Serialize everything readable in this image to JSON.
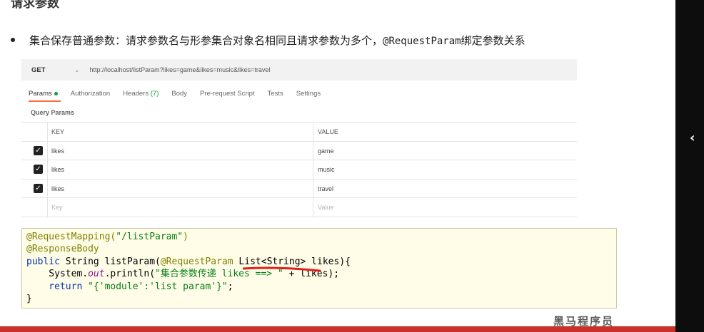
{
  "heading": "请求参数",
  "bullet": {
    "text": "集合保存普通参数：请求参数名与形参集合对象名相同且请求参数为多个，",
    "code": "@RequestParam",
    "tail": "绑定参数关系"
  },
  "postman": {
    "method": "GET",
    "url": "http://localhost/listParam?likes=game&likes=music&likes=travel",
    "tabs": [
      {
        "label": "Params"
      },
      {
        "label": "Authorization"
      },
      {
        "label": "Headers",
        "count": "(7)"
      },
      {
        "label": "Body"
      },
      {
        "label": "Pre-request Script"
      },
      {
        "label": "Tests"
      },
      {
        "label": "Settings"
      }
    ],
    "query_title": "Query Params",
    "headers": {
      "key": "KEY",
      "value": "VALUE"
    },
    "rows": [
      {
        "key": "likes",
        "value": "game"
      },
      {
        "key": "likes",
        "value": "music"
      },
      {
        "key": "likes",
        "value": "travel"
      }
    ],
    "placeholder": {
      "key": "Key",
      "value": "Value"
    }
  },
  "code": {
    "l1_anno": "@RequestMapping(",
    "l1_str": "\"/listParam\"",
    "l1_end": ")",
    "l2_anno": "@ResponseBody",
    "l3_kw": "public ",
    "l3_a": "String listParam(",
    "l3_anno": "@RequestParam",
    "l3_b": " List<String> likes){",
    "l4_a": "    System.",
    "l4_it": "out",
    "l4_b": ".println(",
    "l4_str": "\"集合参数传递 likes ==> \"",
    "l4_c": " + likes);",
    "l5_kw": "    return ",
    "l5_str": "\"{'module':'list param'}\"",
    "l5_end": ";",
    "l6": "}"
  },
  "sidebar_arrow": "‹",
  "watermark": "黑马程序员"
}
